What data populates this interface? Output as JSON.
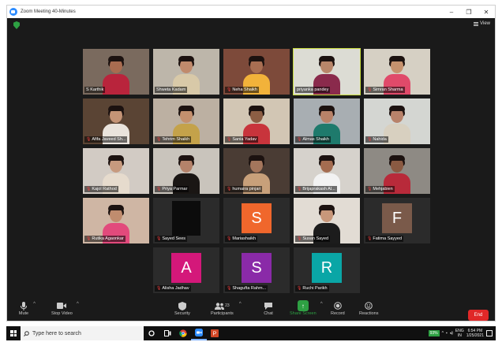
{
  "window": {
    "title": "Zoom Meeting 40-Minutes",
    "controls": [
      "–",
      "❐",
      "✕"
    ]
  },
  "view_label": "View",
  "tiles": [
    {
      "name": "S Karthik",
      "muted": false,
      "kind": "photo",
      "bg": "#7a6a5e",
      "skin": "#a86c50",
      "cloth": "#b9243c"
    },
    {
      "name": "Shweta Kadam",
      "muted": false,
      "kind": "photo",
      "bg": "#bdb6aa",
      "skin": "#c08a6c",
      "cloth": "#d8c9a8"
    },
    {
      "name": "Neha Shaikh",
      "muted": true,
      "kind": "photo",
      "bg": "#7d4a3a",
      "skin": "#a86e52",
      "cloth": "#f2b23a"
    },
    {
      "name": "priyanka pandey",
      "muted": false,
      "kind": "photo",
      "bg": "#dcdcd4",
      "skin": "#b8866a",
      "cloth": "#8a2a4c",
      "active": true
    },
    {
      "name": "Simran Sharma",
      "muted": true,
      "kind": "photo",
      "bg": "#d6d0c4",
      "skin": "#c6926e",
      "cloth": "#e04a6a"
    },
    {
      "name": "Afifa Javeed Sh...",
      "muted": true,
      "kind": "photo",
      "bg": "#5a4434",
      "skin": "#c49476",
      "cloth": "#e9e3dc"
    },
    {
      "name": "Tehrim Shaikh",
      "muted": true,
      "kind": "photo",
      "bg": "#bcb0a2",
      "skin": "#c4906e",
      "cloth": "#c4a24a"
    },
    {
      "name": "Sania Yadav",
      "muted": true,
      "kind": "photo",
      "bg": "#d2c6b4",
      "skin": "#8c5e44",
      "cloth": "#c8343c"
    },
    {
      "name": "Almas Shaikh",
      "muted": true,
      "kind": "photo",
      "bg": "#a8aeb2",
      "skin": "#b88268",
      "cloth": "#1e7a6c"
    },
    {
      "name": "Nahida",
      "muted": true,
      "kind": "photo",
      "bg": "#d4d6d2",
      "skin": "#b8826a",
      "cloth": "#d8d0c0"
    },
    {
      "name": "Kajol Rathod",
      "muted": true,
      "kind": "photo",
      "bg": "#d2cbc4",
      "skin": "#c79a7e",
      "cloth": "#e6dbcd"
    },
    {
      "name": "Priya Parmar",
      "muted": true,
      "kind": "photo",
      "bg": "#c9c4bc",
      "skin": "#b4826a",
      "cloth": "#1a1614"
    },
    {
      "name": "humaira pinjari",
      "muted": true,
      "kind": "photo",
      "bg": "#4a3c34",
      "skin": "#a4765c",
      "cloth": "#c8a07a"
    },
    {
      "name": "Brijaprakash Al...",
      "muted": true,
      "kind": "photo",
      "bg": "#d6d2cc",
      "skin": "#a46c50",
      "cloth": "#f2f2f2"
    },
    {
      "name": "Mehjabien",
      "muted": true,
      "kind": "photo",
      "bg": "#8e8a84",
      "skin": "#8a5a42",
      "cloth": "#b82a3a"
    },
    {
      "name": "Rutika Agaonkar",
      "muted": true,
      "kind": "photo",
      "bg": "#cfb6a4",
      "skin": "#c08c6e",
      "cloth": "#e24a7c"
    },
    {
      "name": "Sayed Sees",
      "muted": true,
      "kind": "dark",
      "bg": "#0c0c0c"
    },
    {
      "name": "Mariashaikh",
      "muted": true,
      "kind": "letter",
      "letter": "S",
      "color": "#f0672c"
    },
    {
      "name": "Susan Sayed",
      "muted": true,
      "kind": "photo",
      "bg": "#e2dcd4",
      "skin": "#c8977a",
      "cloth": "#1c1c1c"
    },
    {
      "name": "Fatima Sayyed",
      "muted": true,
      "kind": "letter",
      "letter": "F",
      "color": "#7a5a4a"
    },
    {
      "name": "Alisha Jadhav",
      "muted": true,
      "kind": "letter",
      "letter": "A",
      "color": "#d4187a"
    },
    {
      "name": "Shagufta Rahm...",
      "muted": true,
      "kind": "letter",
      "letter": "S",
      "color": "#8a2aa8"
    },
    {
      "name": "Ruchi Parikh",
      "muted": true,
      "kind": "letter",
      "letter": "R",
      "color": "#0aa6a6"
    }
  ],
  "toolbar": {
    "mute": "Mute",
    "stop_video": "Stop Video",
    "security": "Security",
    "participants": "Participants",
    "participants_count": "23",
    "chat": "Chat",
    "share_screen": "Share Screen",
    "record": "Record",
    "reactions": "Reactions",
    "end": "End"
  },
  "taskbar": {
    "search_placeholder": "Type here to search",
    "battery": "93%",
    "lang": "ENG",
    "region": "IN",
    "time": "6:54 PM",
    "date": "1/25/2021"
  }
}
